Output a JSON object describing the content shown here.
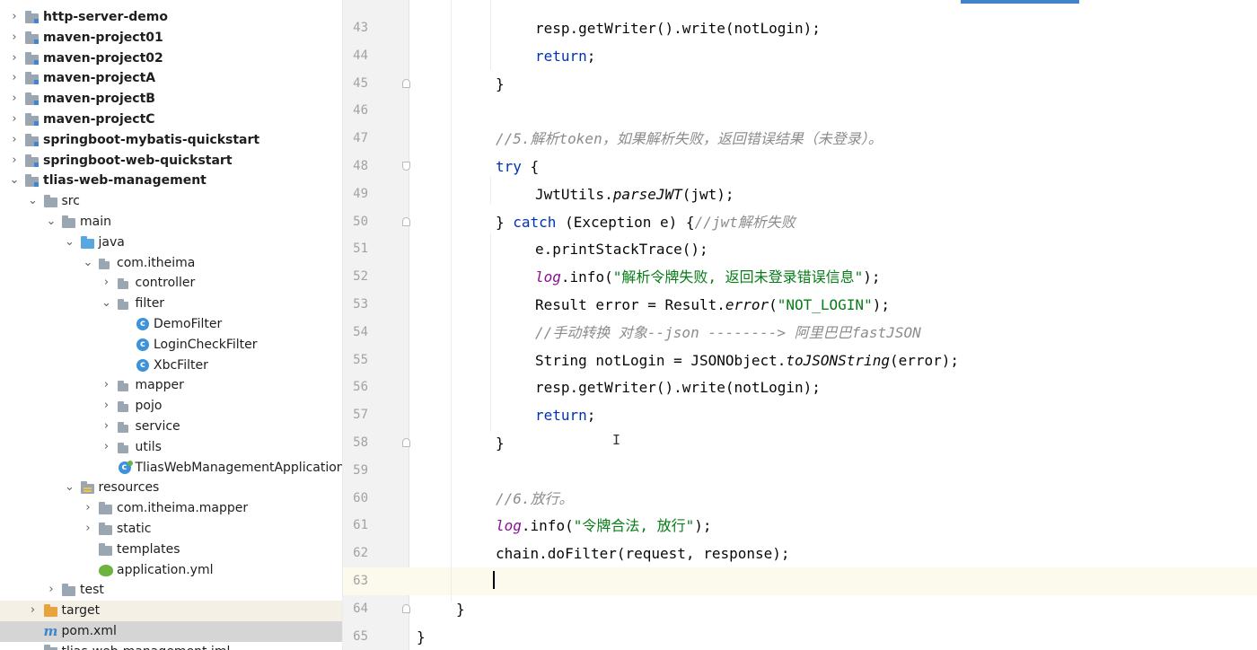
{
  "project_tree": {
    "items": [
      {
        "label": "http-server-demo",
        "indent": 0,
        "arrow": "›",
        "icon": "module-folder-icon",
        "bold": true
      },
      {
        "label": "maven-project01",
        "indent": 0,
        "arrow": "›",
        "icon": "module-folder-icon",
        "bold": true
      },
      {
        "label": "maven-project02",
        "indent": 0,
        "arrow": "›",
        "icon": "module-folder-icon",
        "bold": true
      },
      {
        "label": "maven-projectA",
        "indent": 0,
        "arrow": "›",
        "icon": "module-folder-icon",
        "bold": true
      },
      {
        "label": "maven-projectB",
        "indent": 0,
        "arrow": "›",
        "icon": "module-folder-icon",
        "bold": true
      },
      {
        "label": "maven-projectC",
        "indent": 0,
        "arrow": "›",
        "icon": "module-folder-icon",
        "bold": true
      },
      {
        "label": "springboot-mybatis-quickstart",
        "indent": 0,
        "arrow": "›",
        "icon": "module-folder-icon",
        "bold": true
      },
      {
        "label": "springboot-web-quickstart",
        "indent": 0,
        "arrow": "›",
        "icon": "module-folder-icon",
        "bold": true
      },
      {
        "label": "tlias-web-management",
        "indent": 0,
        "arrow": "⌄",
        "icon": "module-folder-icon",
        "bold": true
      },
      {
        "label": "src",
        "indent": 1,
        "arrow": "⌄",
        "icon": "folder-icon",
        "bold": false
      },
      {
        "label": "main",
        "indent": 2,
        "arrow": "⌄",
        "icon": "folder-icon",
        "bold": false
      },
      {
        "label": "java",
        "indent": 3,
        "arrow": "⌄",
        "icon": "source-folder-icon",
        "bold": false
      },
      {
        "label": "com.itheima",
        "indent": 4,
        "arrow": "⌄",
        "icon": "package-icon",
        "bold": false
      },
      {
        "label": "controller",
        "indent": 5,
        "arrow": "›",
        "icon": "package-icon",
        "bold": false
      },
      {
        "label": "filter",
        "indent": 5,
        "arrow": "⌄",
        "icon": "package-icon",
        "bold": false
      },
      {
        "label": "DemoFilter",
        "indent": 6,
        "arrow": "",
        "icon": "class-icon",
        "bold": false
      },
      {
        "label": "LoginCheckFilter",
        "indent": 6,
        "arrow": "",
        "icon": "class-icon",
        "bold": false
      },
      {
        "label": "XbcFilter",
        "indent": 6,
        "arrow": "",
        "icon": "class-icon",
        "bold": false
      },
      {
        "label": "mapper",
        "indent": 5,
        "arrow": "›",
        "icon": "package-icon",
        "bold": false
      },
      {
        "label": "pojo",
        "indent": 5,
        "arrow": "›",
        "icon": "package-icon",
        "bold": false
      },
      {
        "label": "service",
        "indent": 5,
        "arrow": "›",
        "icon": "package-icon",
        "bold": false
      },
      {
        "label": "utils",
        "indent": 5,
        "arrow": "›",
        "icon": "package-icon",
        "bold": false
      },
      {
        "label": "TliasWebManagementApplication",
        "indent": 5,
        "arrow": "",
        "icon": "spring-app-class-icon",
        "bold": false
      },
      {
        "label": "resources",
        "indent": 3,
        "arrow": "⌄",
        "icon": "resources-folder-icon",
        "bold": false
      },
      {
        "label": "com.itheima.mapper",
        "indent": 4,
        "arrow": "›",
        "icon": "folder-icon",
        "bold": false
      },
      {
        "label": "static",
        "indent": 4,
        "arrow": "›",
        "icon": "folder-icon",
        "bold": false
      },
      {
        "label": "templates",
        "indent": 4,
        "arrow": "",
        "icon": "folder-icon",
        "bold": false
      },
      {
        "label": "application.yml",
        "indent": 4,
        "arrow": "",
        "icon": "yml-file-icon",
        "bold": false
      },
      {
        "label": "test",
        "indent": 2,
        "arrow": "›",
        "icon": "folder-icon",
        "bold": false
      },
      {
        "label": "target",
        "indent": 1,
        "arrow": "›",
        "icon": "excluded-folder-icon",
        "bold": false
      },
      {
        "label": "pom.xml",
        "indent": 1,
        "arrow": "",
        "icon": "maven-pom-icon",
        "bold": false
      },
      {
        "label": "tlias-web-management.iml",
        "indent": 1,
        "arrow": "",
        "icon": "iml-file-icon",
        "bold": false
      }
    ]
  },
  "editor": {
    "lines": [
      {
        "num": "43",
        "indent": 3,
        "tokens": [
          {
            "t": "resp.getWriter().write(notLogin);",
            "c": ""
          }
        ]
      },
      {
        "num": "44",
        "indent": 3,
        "tokens": [
          {
            "t": "return",
            "c": "kw"
          },
          {
            "t": ";",
            "c": ""
          }
        ]
      },
      {
        "num": "45",
        "indent": 2,
        "tokens": [
          {
            "t": "}",
            "c": ""
          }
        ],
        "fold": "up"
      },
      {
        "num": "46",
        "indent": 2,
        "tokens": []
      },
      {
        "num": "47",
        "indent": 2,
        "tokens": [
          {
            "t": "//5.解析token，如果解析失败，返回错误结果（未登录）。",
            "c": "cmt"
          }
        ]
      },
      {
        "num": "48",
        "indent": 2,
        "tokens": [
          {
            "t": "try",
            "c": "kw"
          },
          {
            "t": " {",
            "c": ""
          }
        ],
        "fold": "down"
      },
      {
        "num": "49",
        "indent": 3,
        "tokens": [
          {
            "t": "JwtUtils.",
            "c": ""
          },
          {
            "t": "parseJWT",
            "c": "it"
          },
          {
            "t": "(jwt);",
            "c": ""
          }
        ]
      },
      {
        "num": "50",
        "indent": 2,
        "tokens": [
          {
            "t": "} ",
            "c": ""
          },
          {
            "t": "catch",
            "c": "kw"
          },
          {
            "t": " (Exception e) {",
            "c": ""
          },
          {
            "t": "//jwt解析失败",
            "c": "cmt"
          }
        ],
        "fold": "up"
      },
      {
        "num": "51",
        "indent": 3,
        "tokens": [
          {
            "t": "e.printStackTrace();",
            "c": ""
          }
        ]
      },
      {
        "num": "52",
        "indent": 3,
        "tokens": [
          {
            "t": "log",
            "c": "fld"
          },
          {
            "t": ".info(",
            "c": ""
          },
          {
            "t": "\"解析令牌失败, 返回未登录错误信息\"",
            "c": "str"
          },
          {
            "t": ");",
            "c": ""
          }
        ]
      },
      {
        "num": "53",
        "indent": 3,
        "tokens": [
          {
            "t": "Result error = Result.",
            "c": ""
          },
          {
            "t": "error",
            "c": "it"
          },
          {
            "t": "(",
            "c": ""
          },
          {
            "t": "\"NOT_LOGIN\"",
            "c": "str"
          },
          {
            "t": ");",
            "c": ""
          }
        ]
      },
      {
        "num": "54",
        "indent": 3,
        "tokens": [
          {
            "t": "//手动转换 对象--json --------> 阿里巴巴fastJSON",
            "c": "cmt"
          }
        ]
      },
      {
        "num": "55",
        "indent": 3,
        "tokens": [
          {
            "t": "String notLogin = JSONObject.",
            "c": ""
          },
          {
            "t": "toJSONString",
            "c": "it"
          },
          {
            "t": "(error);",
            "c": ""
          }
        ]
      },
      {
        "num": "56",
        "indent": 3,
        "tokens": [
          {
            "t": "resp.getWriter().write(notLogin);",
            "c": ""
          }
        ]
      },
      {
        "num": "57",
        "indent": 3,
        "tokens": [
          {
            "t": "return",
            "c": "kw"
          },
          {
            "t": ";",
            "c": ""
          }
        ]
      },
      {
        "num": "58",
        "indent": 2,
        "tokens": [
          {
            "t": "}",
            "c": ""
          }
        ],
        "fold": "up"
      },
      {
        "num": "59",
        "indent": 2,
        "tokens": []
      },
      {
        "num": "60",
        "indent": 2,
        "tokens": [
          {
            "t": "//6.放行。",
            "c": "cmt"
          }
        ]
      },
      {
        "num": "61",
        "indent": 2,
        "tokens": [
          {
            "t": "log",
            "c": "fld"
          },
          {
            "t": ".info(",
            "c": ""
          },
          {
            "t": "\"令牌合法, 放行\"",
            "c": "str"
          },
          {
            "t": ");",
            "c": ""
          }
        ]
      },
      {
        "num": "62",
        "indent": 2,
        "tokens": [
          {
            "t": "chain.doFilter(request, response);",
            "c": ""
          }
        ]
      },
      {
        "num": "63",
        "indent": 2,
        "tokens": [],
        "current": true
      },
      {
        "num": "64",
        "indent": 1,
        "tokens": [
          {
            "t": "}",
            "c": ""
          }
        ],
        "fold": "up"
      },
      {
        "num": "65",
        "indent": 0,
        "tokens": [
          {
            "t": "}",
            "c": ""
          }
        ]
      }
    ]
  }
}
